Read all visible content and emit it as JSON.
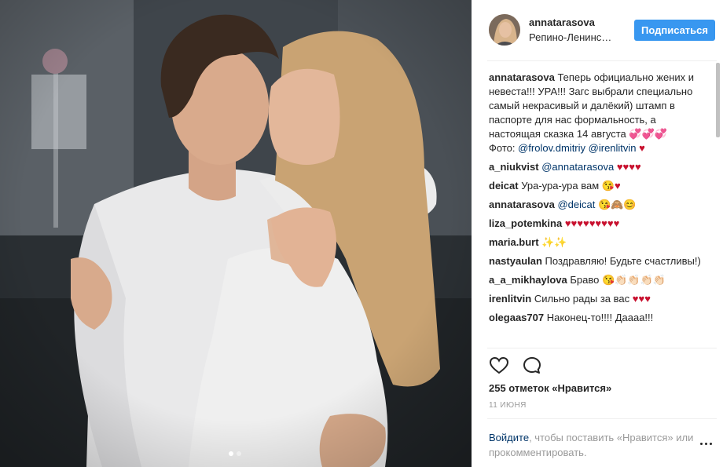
{
  "post": {
    "photo": {
      "description_icon": "couple-photo",
      "carousel": {
        "count": 2,
        "active_index": 0
      }
    },
    "header": {
      "username": "annatarasova",
      "location": "Репино-Ленинс…",
      "follow_label": "Подписаться"
    },
    "caption": {
      "user": "annatarasova",
      "text": "Теперь официально жених и невеста!!! УРА!!! Загс выбрали специально самый некрасивый и далёкий) штамп в паспорте для нас формальность, а настоящая сказка 14 августа 💞💞💞",
      "photo_label": "Фото:",
      "mention1": "@frolov.dmitriy",
      "mention2": "@irenlitvin",
      "emoji": "♥"
    },
    "comments": [
      {
        "user": "a_niukvist",
        "mention": "@annatarasova",
        "text": "",
        "emoji": "♥♥♥♥"
      },
      {
        "user": "deicat",
        "mention": "",
        "text": "Ура-ура-ура вам",
        "emoji": "😘♥"
      },
      {
        "user": "annatarasova",
        "mention": "@deicat",
        "text": "",
        "emoji": "😘🙈😊"
      },
      {
        "user": "liza_potemkina",
        "mention": "",
        "text": "",
        "emoji": "♥♥♥♥♥♥♥♥♥"
      },
      {
        "user": "maria.burt",
        "mention": "",
        "text": "",
        "emoji": "✨✨"
      },
      {
        "user": "nastyaulan",
        "mention": "",
        "text": "Поздравляю! Будьте счастливы!)",
        "emoji": ""
      },
      {
        "user": "a_a_mikhaylova",
        "mention": "",
        "text": "Браво",
        "emoji": "😘👏🏻👏🏻👏🏻👏🏻"
      },
      {
        "user": "irenlitvin",
        "mention": "",
        "text": "Сильно рады за вас",
        "emoji": "♥♥♥"
      },
      {
        "user": "olegaas707",
        "mention": "",
        "text": "Наконец-то!!!! Даааа!!!",
        "emoji": ""
      }
    ],
    "actions": {
      "like_icon": "heart-outline-icon",
      "comment_icon": "speech-bubble-icon"
    },
    "likes_text": "255 отметок «Нравится»",
    "date": "11 ИЮНЯ",
    "login_link": "Войдите",
    "login_text": ", чтобы поставить «Нравится» или прокомментировать.",
    "more_icon": "more-options-icon"
  },
  "colors": {
    "accent": "#3897f0",
    "link": "#003569",
    "muted": "#999999",
    "heart": "#c8102e"
  }
}
